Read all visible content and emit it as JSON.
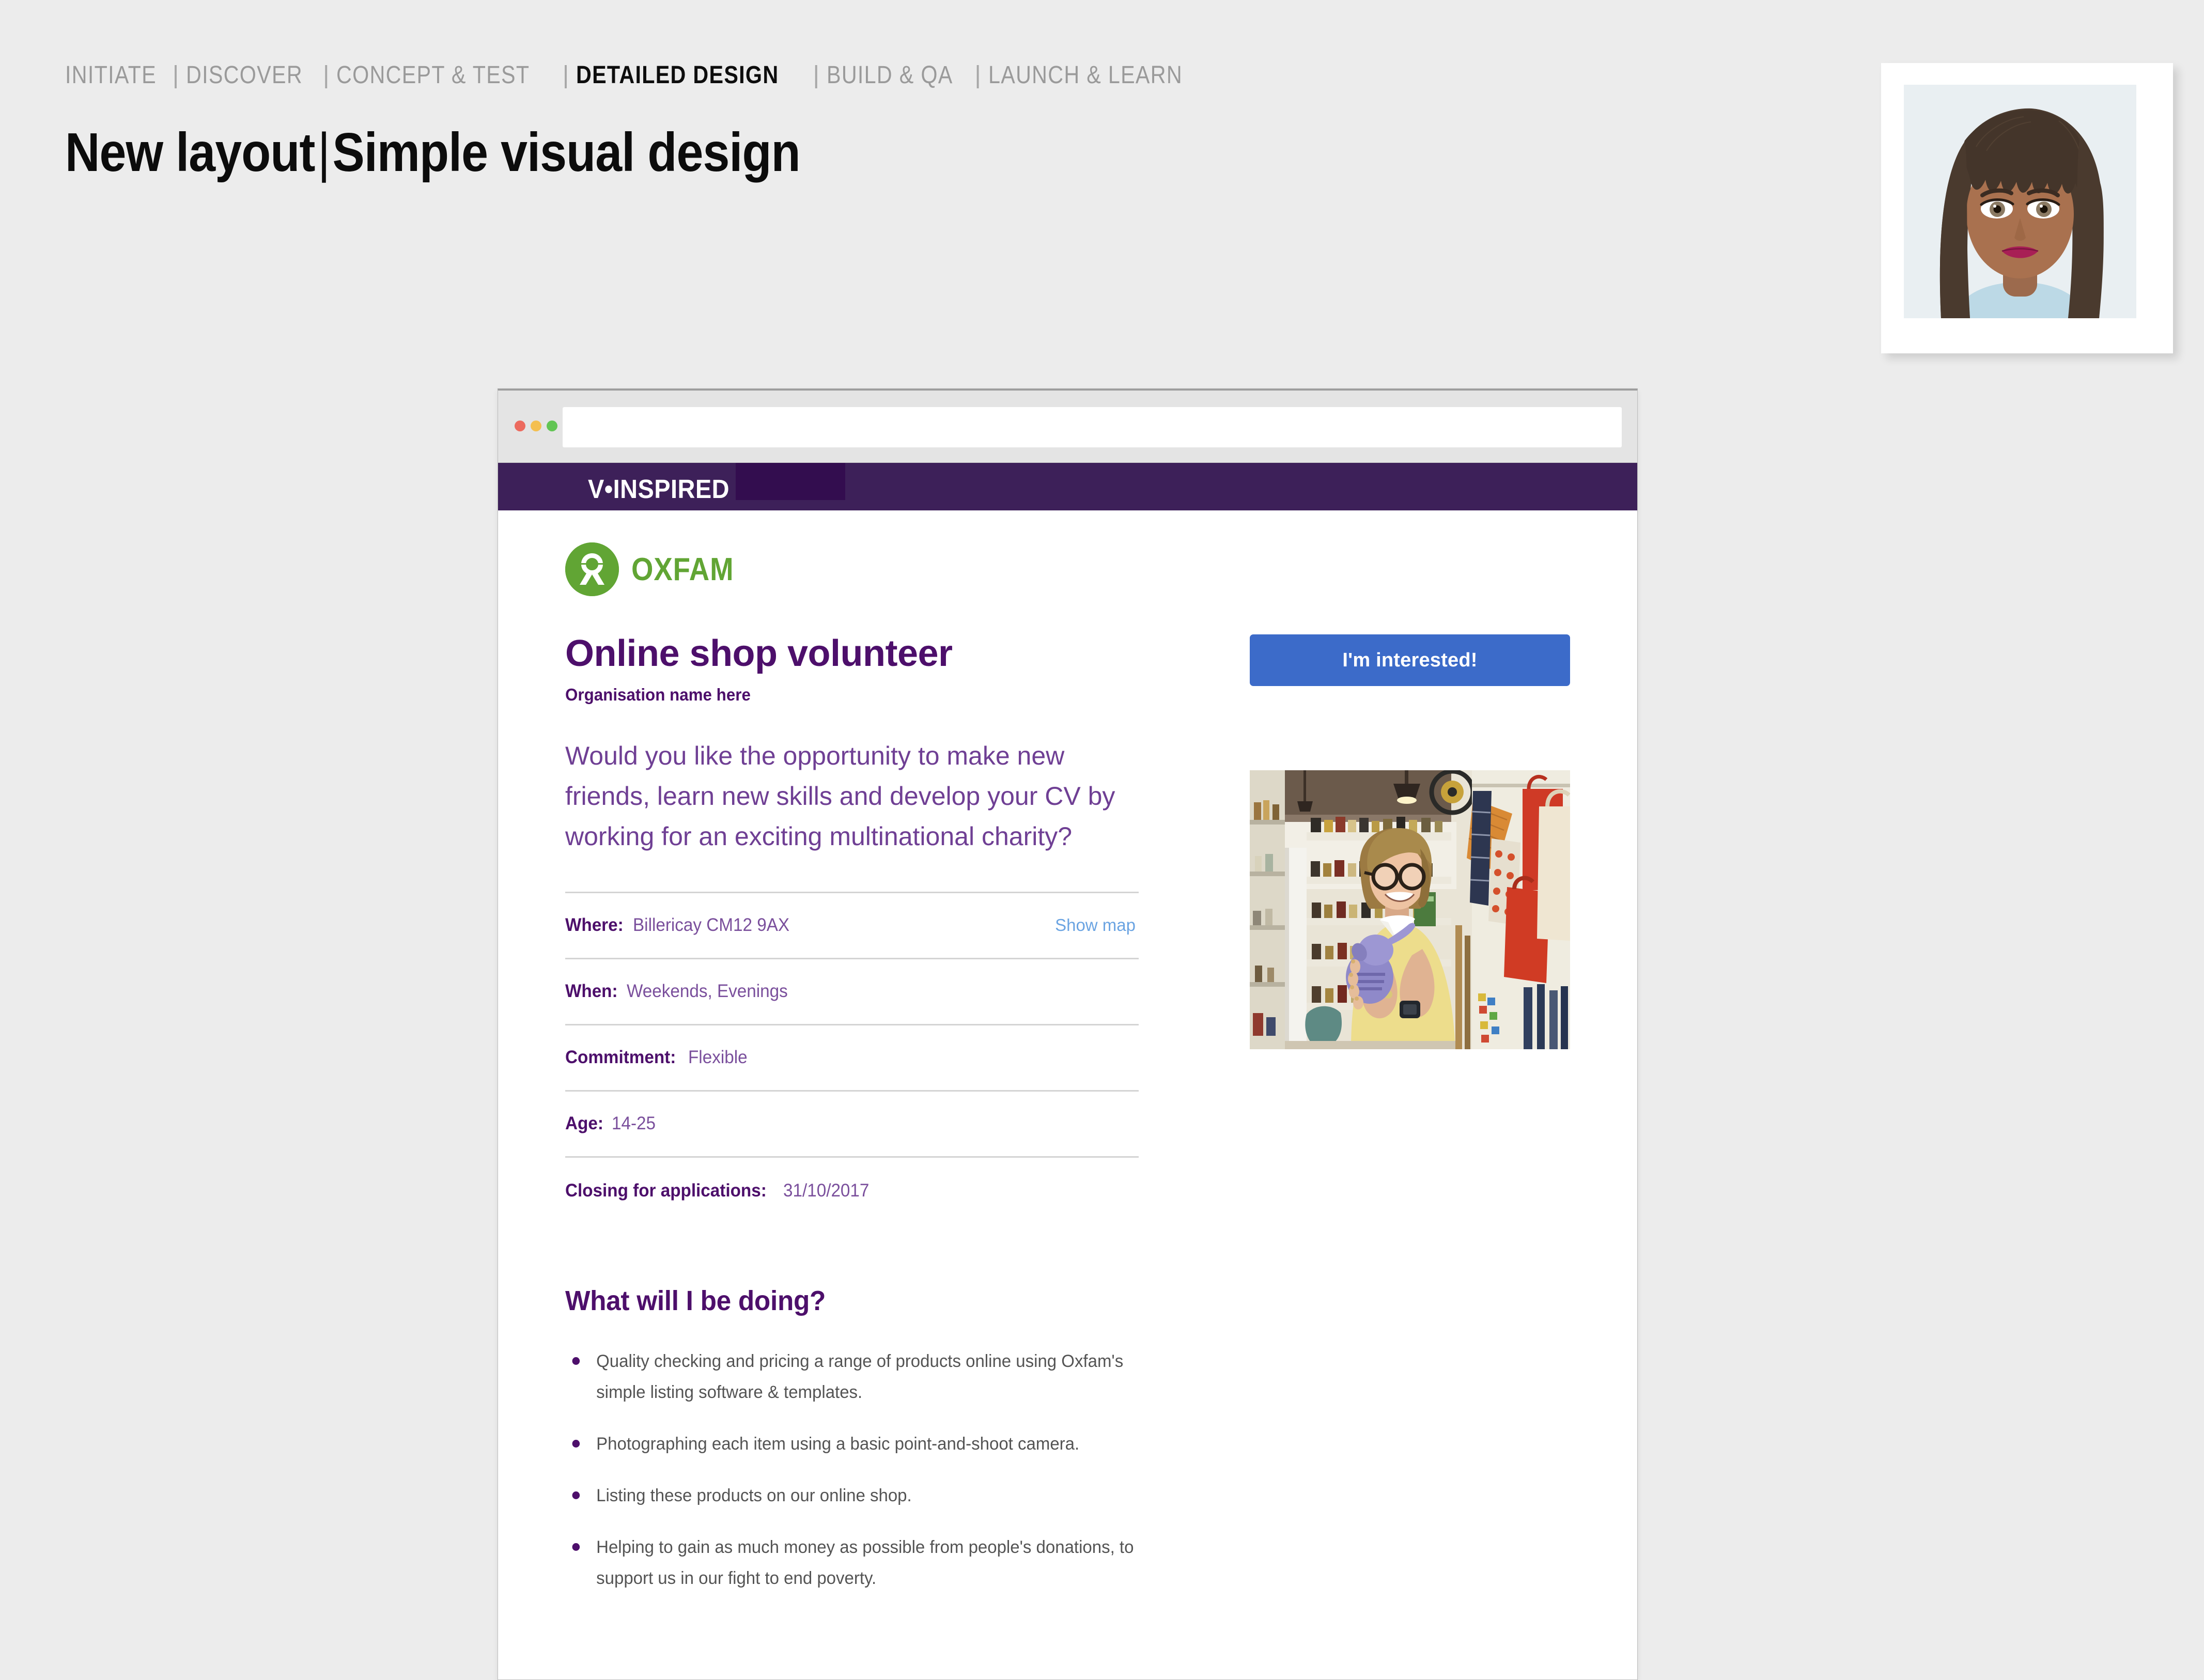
{
  "slide": {
    "breadcrumb": [
      {
        "label": "INITIATE",
        "active": false
      },
      {
        "label": "DISCOVER",
        "active": false
      },
      {
        "label": "CONCEPT & TEST",
        "active": false
      },
      {
        "label": "DETAILED DESIGN",
        "active": true
      },
      {
        "label": "BUILD & QA",
        "active": false
      },
      {
        "label": "LAUNCH & LEARN",
        "active": false
      }
    ],
    "separator": "|",
    "title_main": "New layout",
    "title_divider": "|",
    "title_sub": "Simple visual design"
  },
  "persona": {
    "name": "persona-avatar",
    "background_color": "#e9eff2"
  },
  "browser": {
    "traffic_lights": [
      "close",
      "minimize",
      "maximize"
    ],
    "url_value": "",
    "url_placeholder": ""
  },
  "site": {
    "brand": "V•INSPIRED",
    "brand_bar_color": "#3d2059",
    "brand_block_color": "#330d4f"
  },
  "org": {
    "logo_text": "OXFAM",
    "logo_color": "#61a534"
  },
  "listing": {
    "job_title": "Online shop volunteer",
    "organisation": "Organisation name here",
    "intro": "Would you like the opportunity to make new friends, learn new skills and develop your CV by working for an exciting multinational charity?",
    "cta_label": "I'm interested!",
    "cta_color": "#3c6bc9",
    "details": [
      {
        "label": "Where:",
        "value": "Billericay CM12 9AX",
        "action": "Show map"
      },
      {
        "label": "When:",
        "value": "Weekends, Evenings",
        "action": ""
      },
      {
        "label": "Commitment:",
        "value": "Flexible",
        "action": ""
      },
      {
        "label": "Age:",
        "value": "14-25",
        "action": ""
      },
      {
        "label": "Closing for applications:",
        "value": "31/10/2017",
        "action": ""
      }
    ],
    "doing_heading": "What will I be doing?",
    "doing_items": [
      "Quality checking and pricing a range of products online using Oxfam's simple listing software & templates.",
      "Photographing each item using a basic point-and-shoot camera.",
      "Listing these products on our online shop.",
      "Helping to gain as much money as possible from people's donations, to support us in our fight to end poverty."
    ]
  }
}
